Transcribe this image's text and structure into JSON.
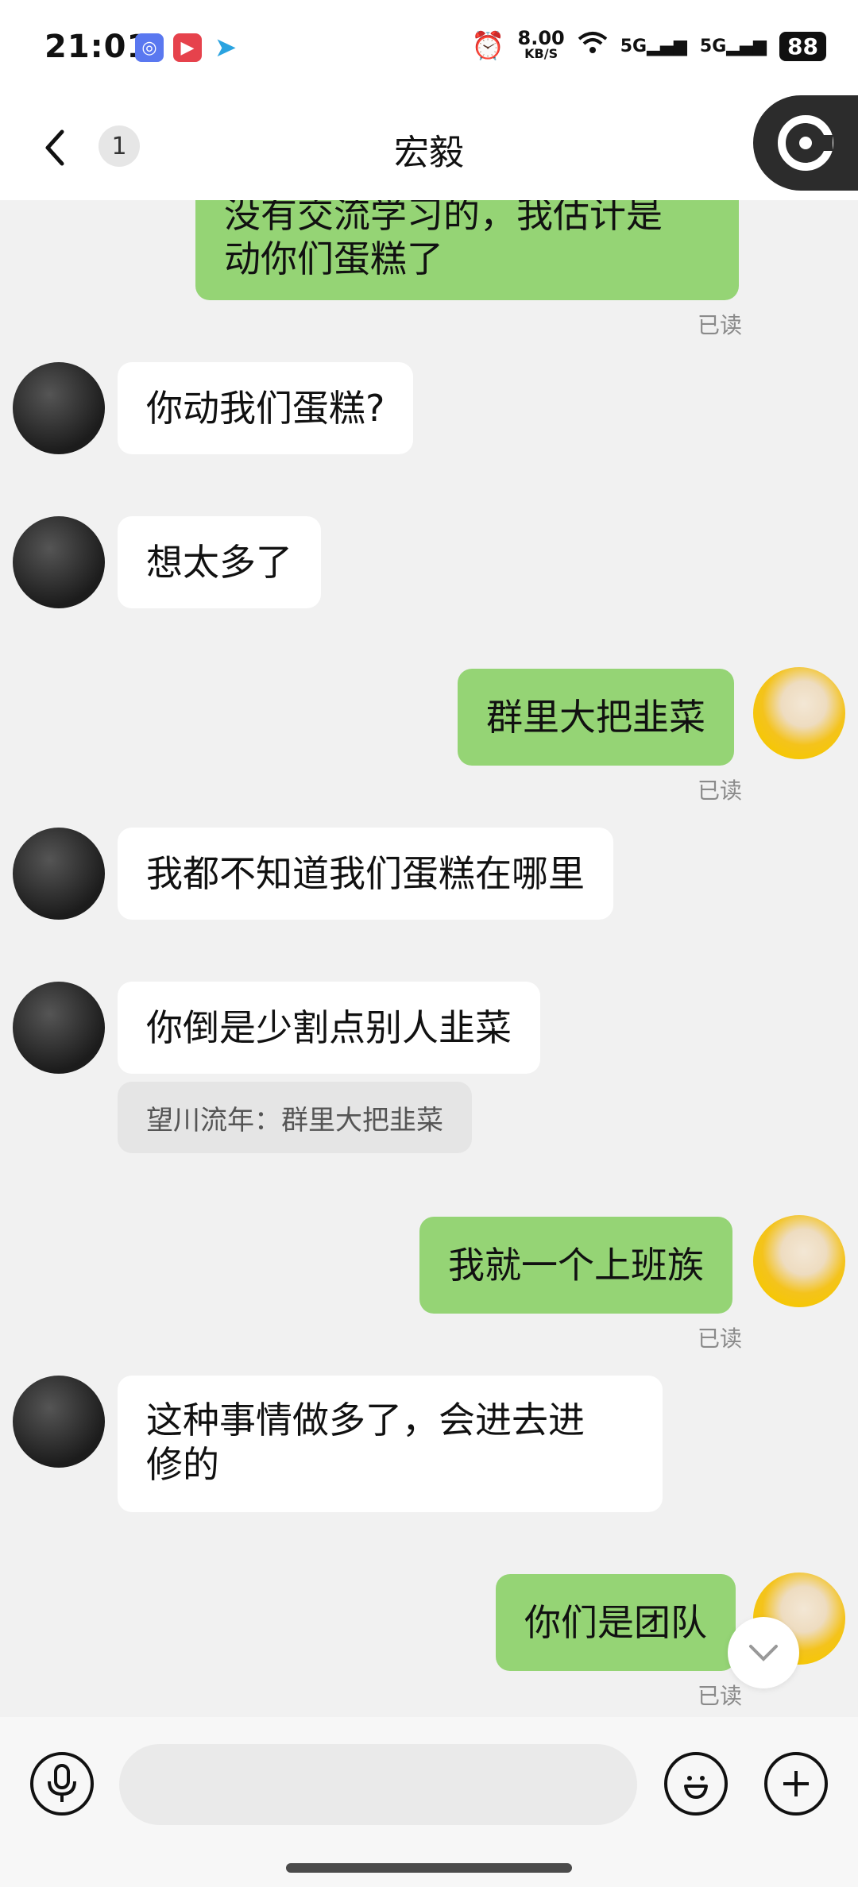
{
  "status": {
    "time": "21:01",
    "net_speed": "8.00",
    "net_unit": "KB/S",
    "signal1": "5G",
    "signal2": "5G",
    "battery": "88"
  },
  "header": {
    "title": "宏毅",
    "unread_count": "1"
  },
  "messages": [
    {
      "side": "out",
      "text_line1": "没有交流学习的，我估计是",
      "text_line2": "动你们蛋糕了",
      "read": "已读"
    },
    {
      "side": "in",
      "text": "你动我们蛋糕?"
    },
    {
      "side": "in",
      "text": "想太多了"
    },
    {
      "side": "out",
      "text": "群里大把韭菜",
      "read": "已读"
    },
    {
      "side": "in",
      "text": "我都不知道我们蛋糕在哪里"
    },
    {
      "side": "in",
      "text": "你倒是少割点别人韭菜",
      "quote": "望川流年：群里大把韭菜"
    },
    {
      "side": "out",
      "text": "我就一个上班族",
      "read": "已读"
    },
    {
      "side": "in",
      "text_line1": "这种事情做多了，会进去进",
      "text_line2": "修的"
    },
    {
      "side": "out",
      "text": "你们是团队",
      "read": "已读"
    }
  ],
  "composer": {
    "placeholder": ""
  },
  "icons": {
    "back": "chevron-left-icon",
    "voice": "microphone-icon",
    "emoji": "emoji-icon",
    "more": "plus-icon",
    "scroll": "chevron-down-icon",
    "floating": "floating-ball-icon"
  },
  "colors": {
    "outgoing_bubble": "#95d475",
    "incoming_bubble": "#ffffff",
    "background": "#f1f1f1"
  }
}
